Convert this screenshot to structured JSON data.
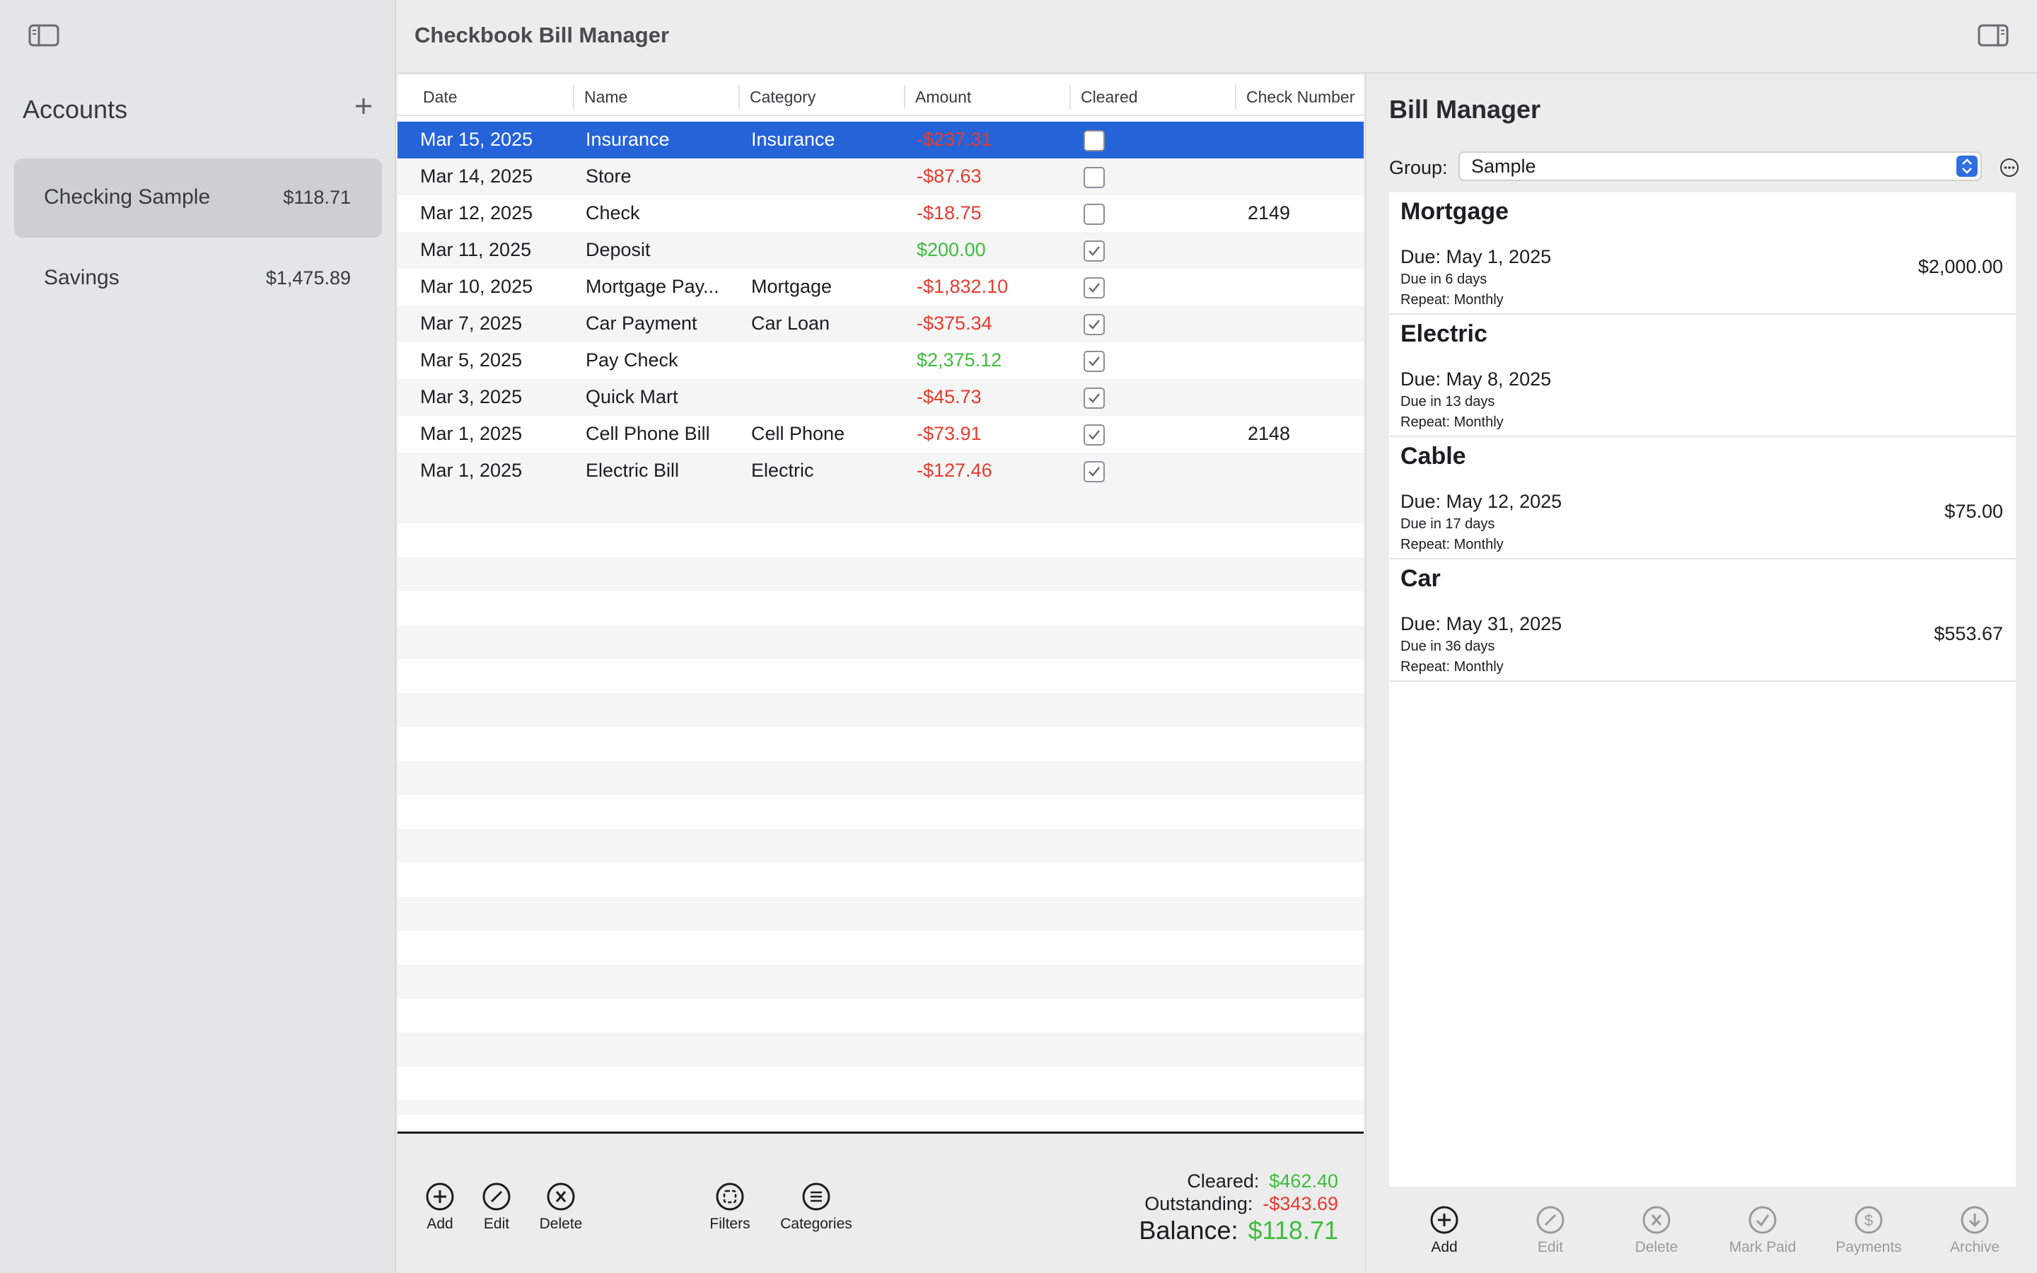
{
  "sidebar": {
    "title": "Accounts",
    "accounts": [
      {
        "name": "Checking Sample",
        "balance": "$118.71"
      },
      {
        "name": "Savings",
        "balance": "$1,475.89"
      }
    ]
  },
  "titlebar": {
    "title": "Checkbook Bill Manager"
  },
  "table": {
    "columns": [
      "Date",
      "Name",
      "Category",
      "Amount",
      "Cleared",
      "Check Number"
    ],
    "rows": [
      {
        "date": "Mar 15, 2025",
        "name": "Insurance",
        "category": "Insurance",
        "amount": "-$237.31",
        "cleared": false,
        "check": ""
      },
      {
        "date": "Mar 14, 2025",
        "name": "Store",
        "category": "",
        "amount": "-$87.63",
        "cleared": false,
        "check": ""
      },
      {
        "date": "Mar 12, 2025",
        "name": "Check",
        "category": "",
        "amount": "-$18.75",
        "cleared": false,
        "check": "2149"
      },
      {
        "date": "Mar 11, 2025",
        "name": "Deposit",
        "category": "",
        "amount": "$200.00",
        "cleared": true,
        "check": ""
      },
      {
        "date": "Mar 10, 2025",
        "name": "Mortgage Pay...",
        "category": "Mortgage",
        "amount": "-$1,832.10",
        "cleared": true,
        "check": ""
      },
      {
        "date": "Mar 7, 2025",
        "name": "Car Payment",
        "category": "Car Loan",
        "amount": "-$375.34",
        "cleared": true,
        "check": ""
      },
      {
        "date": "Mar 5, 2025",
        "name": "Pay Check",
        "category": "",
        "amount": "$2,375.12",
        "cleared": true,
        "check": ""
      },
      {
        "date": "Mar 3, 2025",
        "name": "Quick Mart",
        "category": "",
        "amount": "-$45.73",
        "cleared": true,
        "check": ""
      },
      {
        "date": "Mar 1, 2025",
        "name": "Cell Phone Bill",
        "category": "Cell Phone",
        "amount": "-$73.91",
        "cleared": true,
        "check": "2148"
      },
      {
        "date": "Mar 1, 2025",
        "name": "Electric Bill",
        "category": "Electric",
        "amount": "-$127.46",
        "cleared": true,
        "check": ""
      }
    ]
  },
  "toolbar": {
    "add": "Add",
    "edit": "Edit",
    "delete": "Delete",
    "filters": "Filters",
    "categories": "Categories"
  },
  "totals": {
    "cleared_label": "Cleared:",
    "cleared_value": "$462.40",
    "outstanding_label": "Outstanding:",
    "outstanding_value": "-$343.69",
    "balance_label": "Balance:",
    "balance_value": "$118.71"
  },
  "bill_manager": {
    "title": "Bill Manager",
    "group_label": "Group:",
    "group_value": "Sample",
    "bills": [
      {
        "name": "Mortgage",
        "due": "Due: May 1, 2025",
        "due_in": "Due in 6 days",
        "repeat": "Repeat: Monthly",
        "amount": "$2,000.00"
      },
      {
        "name": "Electric",
        "due": "Due: May 8, 2025",
        "due_in": "Due in 13 days",
        "repeat": "Repeat: Monthly",
        "amount": ""
      },
      {
        "name": "Cable",
        "due": "Due: May 12, 2025",
        "due_in": "Due in 17 days",
        "repeat": "Repeat: Monthly",
        "amount": "$75.00"
      },
      {
        "name": "Car",
        "due": "Due: May 31, 2025",
        "due_in": "Due in 36 days",
        "repeat": "Repeat: Monthly",
        "amount": "$553.67"
      }
    ],
    "footer": {
      "add": "Add",
      "edit": "Edit",
      "delete": "Delete",
      "mark_paid": "Mark Paid",
      "payments": "Payments",
      "archive": "Archive"
    }
  },
  "colors": {
    "accent": "#2563d9",
    "negative": "#e63b2e",
    "positive": "#3ebc3e"
  },
  "icons": [
    "sidebar-toggle-icon",
    "plus-icon",
    "inspector-toggle-icon",
    "add-circle-icon",
    "edit-circle-icon",
    "delete-circle-icon",
    "filters-icon",
    "categories-icon",
    "checkmark-icon",
    "mark-paid-icon",
    "payments-icon",
    "archive-icon",
    "more-icon",
    "stepper-icon"
  ]
}
